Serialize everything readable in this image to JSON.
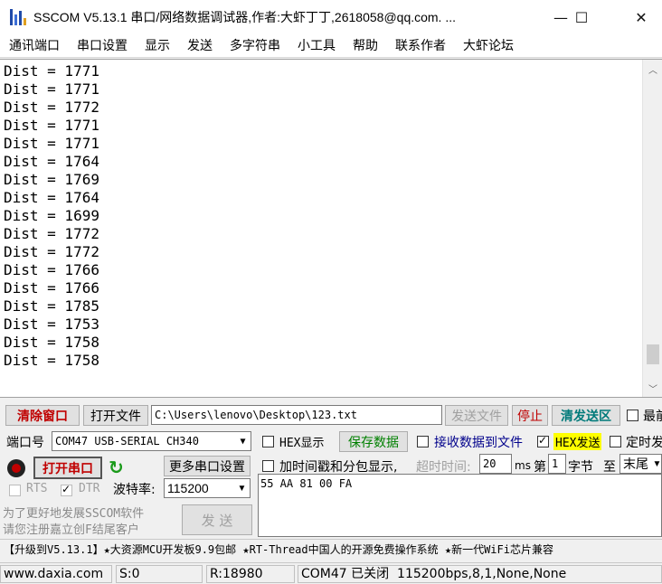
{
  "window": {
    "title": "SSCOM V5.13.1 串口/网络数据调试器,作者:大虾丁丁,2618058@qq.com. ...",
    "min_label": "—",
    "max_label": "☐",
    "close_label": "✕"
  },
  "menu": [
    "通讯端口",
    "串口设置",
    "显示",
    "发送",
    "多字符串",
    "小工具",
    "帮助",
    "联系作者",
    "大虾论坛"
  ],
  "output": {
    "lines": [
      "Dist = 1771",
      "Dist = 1771",
      "Dist = 1772",
      "Dist = 1771",
      "Dist = 1771",
      "Dist = 1764",
      "Dist = 1769",
      "Dist = 1764",
      "Dist = 1699",
      "Dist = 1772",
      "Dist = 1772",
      "Dist = 1766",
      "Dist = 1766",
      "Dist = 1785",
      "Dist = 1753",
      "Dist = 1758",
      "Dist = 1758"
    ],
    "scroll_position": 0.95
  },
  "file_row": {
    "clear_window": "清除窗口",
    "open_file": "打开文件",
    "file_path": "C:\\Users\\lenovo\\Desktop\\123.txt",
    "send_file": "发送文件",
    "stop": "停止",
    "clear_send": "清发送区",
    "topmost": "最前"
  },
  "port_row": {
    "port_label": "端口号",
    "port_value": "COM47 USB-SERIAL CH340",
    "hex_display": "HEX显示",
    "save_data": "保存数据",
    "recv_to_file": "接收数据到文件",
    "hex_send": "HEX发送",
    "timed_send": "定时发"
  },
  "open_row": {
    "open_port": "打开串口",
    "more_settings": "更多串口设置",
    "timestamp": "加时间戳和分包显示,",
    "timeout_label": "超时时间:",
    "timeout_value": "20",
    "timeout_unit": "ms",
    "nth_label": "第",
    "nth_value": "1",
    "byte_label": "字节",
    "to_label": "至",
    "end_value": "末尾"
  },
  "baud_row": {
    "rts": "RTS",
    "dtr": "DTR",
    "baud_label": "波特率:",
    "baud_value": "115200"
  },
  "send_text": "55 AA 81 00 FA",
  "promo_left": {
    "line1": "为了更好地发展SSCOM软件",
    "line2": "请您注册嘉立创F结尾客户",
    "send_button": "发  送"
  },
  "promo_bar": "【升级到V5.13.1】★大资源MCU开发板9.9包邮 ★RT-Thread中国人的开源免费操作系统 ★新一代WiFi芯片兼容",
  "status": {
    "website": "www.daxia.com",
    "sent": "S:0",
    "received": "R:18980",
    "port_state": "COM47 已关闭  115200bps,8,1,None,None"
  }
}
